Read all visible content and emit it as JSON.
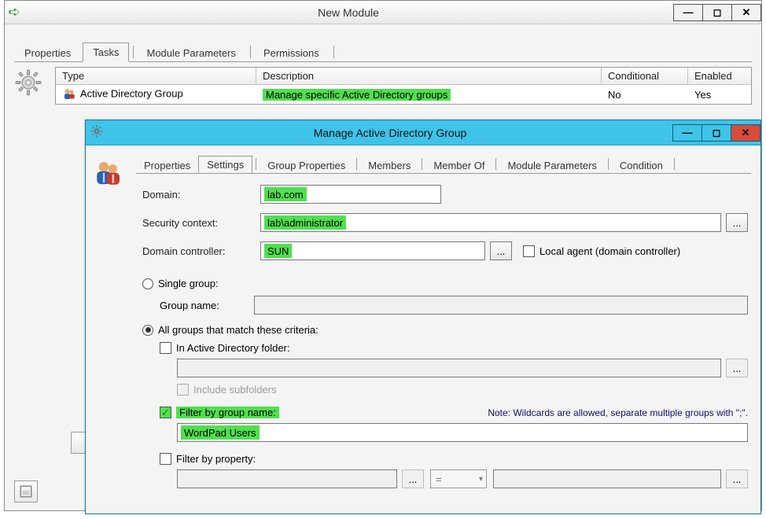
{
  "back_window": {
    "title": "New Module",
    "tabs": [
      "Properties",
      "Tasks",
      "Module Parameters",
      "Permissions"
    ],
    "active_tab_index": 1,
    "table": {
      "headers": {
        "type": "Type",
        "description": "Description",
        "conditional": "Conditional",
        "enabled": "Enabled"
      },
      "row": {
        "type": "Active Directory Group",
        "description": "Manage specific Active Directory groups",
        "conditional": "No",
        "enabled": "Yes"
      }
    }
  },
  "front_window": {
    "title": "Manage Active Directory Group",
    "tabs": [
      "Properties",
      "Settings",
      "Group Properties",
      "Members",
      "Member Of",
      "Module Parameters",
      "Condition"
    ],
    "active_tab_index": 1,
    "labels": {
      "domain": "Domain:",
      "security_context": "Security context:",
      "domain_controller": "Domain controller:",
      "local_agent": "Local agent (domain controller)",
      "single_group": "Single group:",
      "group_name": "Group name:",
      "all_groups": "All groups that match these criteria:",
      "in_ad_folder": "In Active Directory folder:",
      "include_subfolders": "Include subfolders",
      "filter_by_group_name": "Filter by group name:",
      "filter_note": "Note: Wildcards are allowed, separate multiple groups with \";\".",
      "filter_by_property": "Filter by property:"
    },
    "values": {
      "domain": "lab.com",
      "security_context": "lab\\administrator",
      "domain_controller": "SUN",
      "group_name": "",
      "ad_folder": "",
      "filter_group_name": "WordPad Users",
      "filter_property_left": "",
      "filter_property_op": "=",
      "filter_property_right": ""
    },
    "state": {
      "local_agent_checked": false,
      "mode_single_selected": false,
      "mode_all_selected": true,
      "in_ad_folder_checked": false,
      "include_subfolders_checked": false,
      "filter_by_group_name_checked": true,
      "filter_by_property_checked": false
    },
    "browse_label": "...",
    "colors": {
      "highlight": "#4fe04f",
      "titlebar": "#3fc3e8",
      "close": "#d94b3a"
    }
  },
  "icons": {
    "gear": "gear-icon",
    "people": "people-icon",
    "arrow": "nav-forward-icon"
  }
}
